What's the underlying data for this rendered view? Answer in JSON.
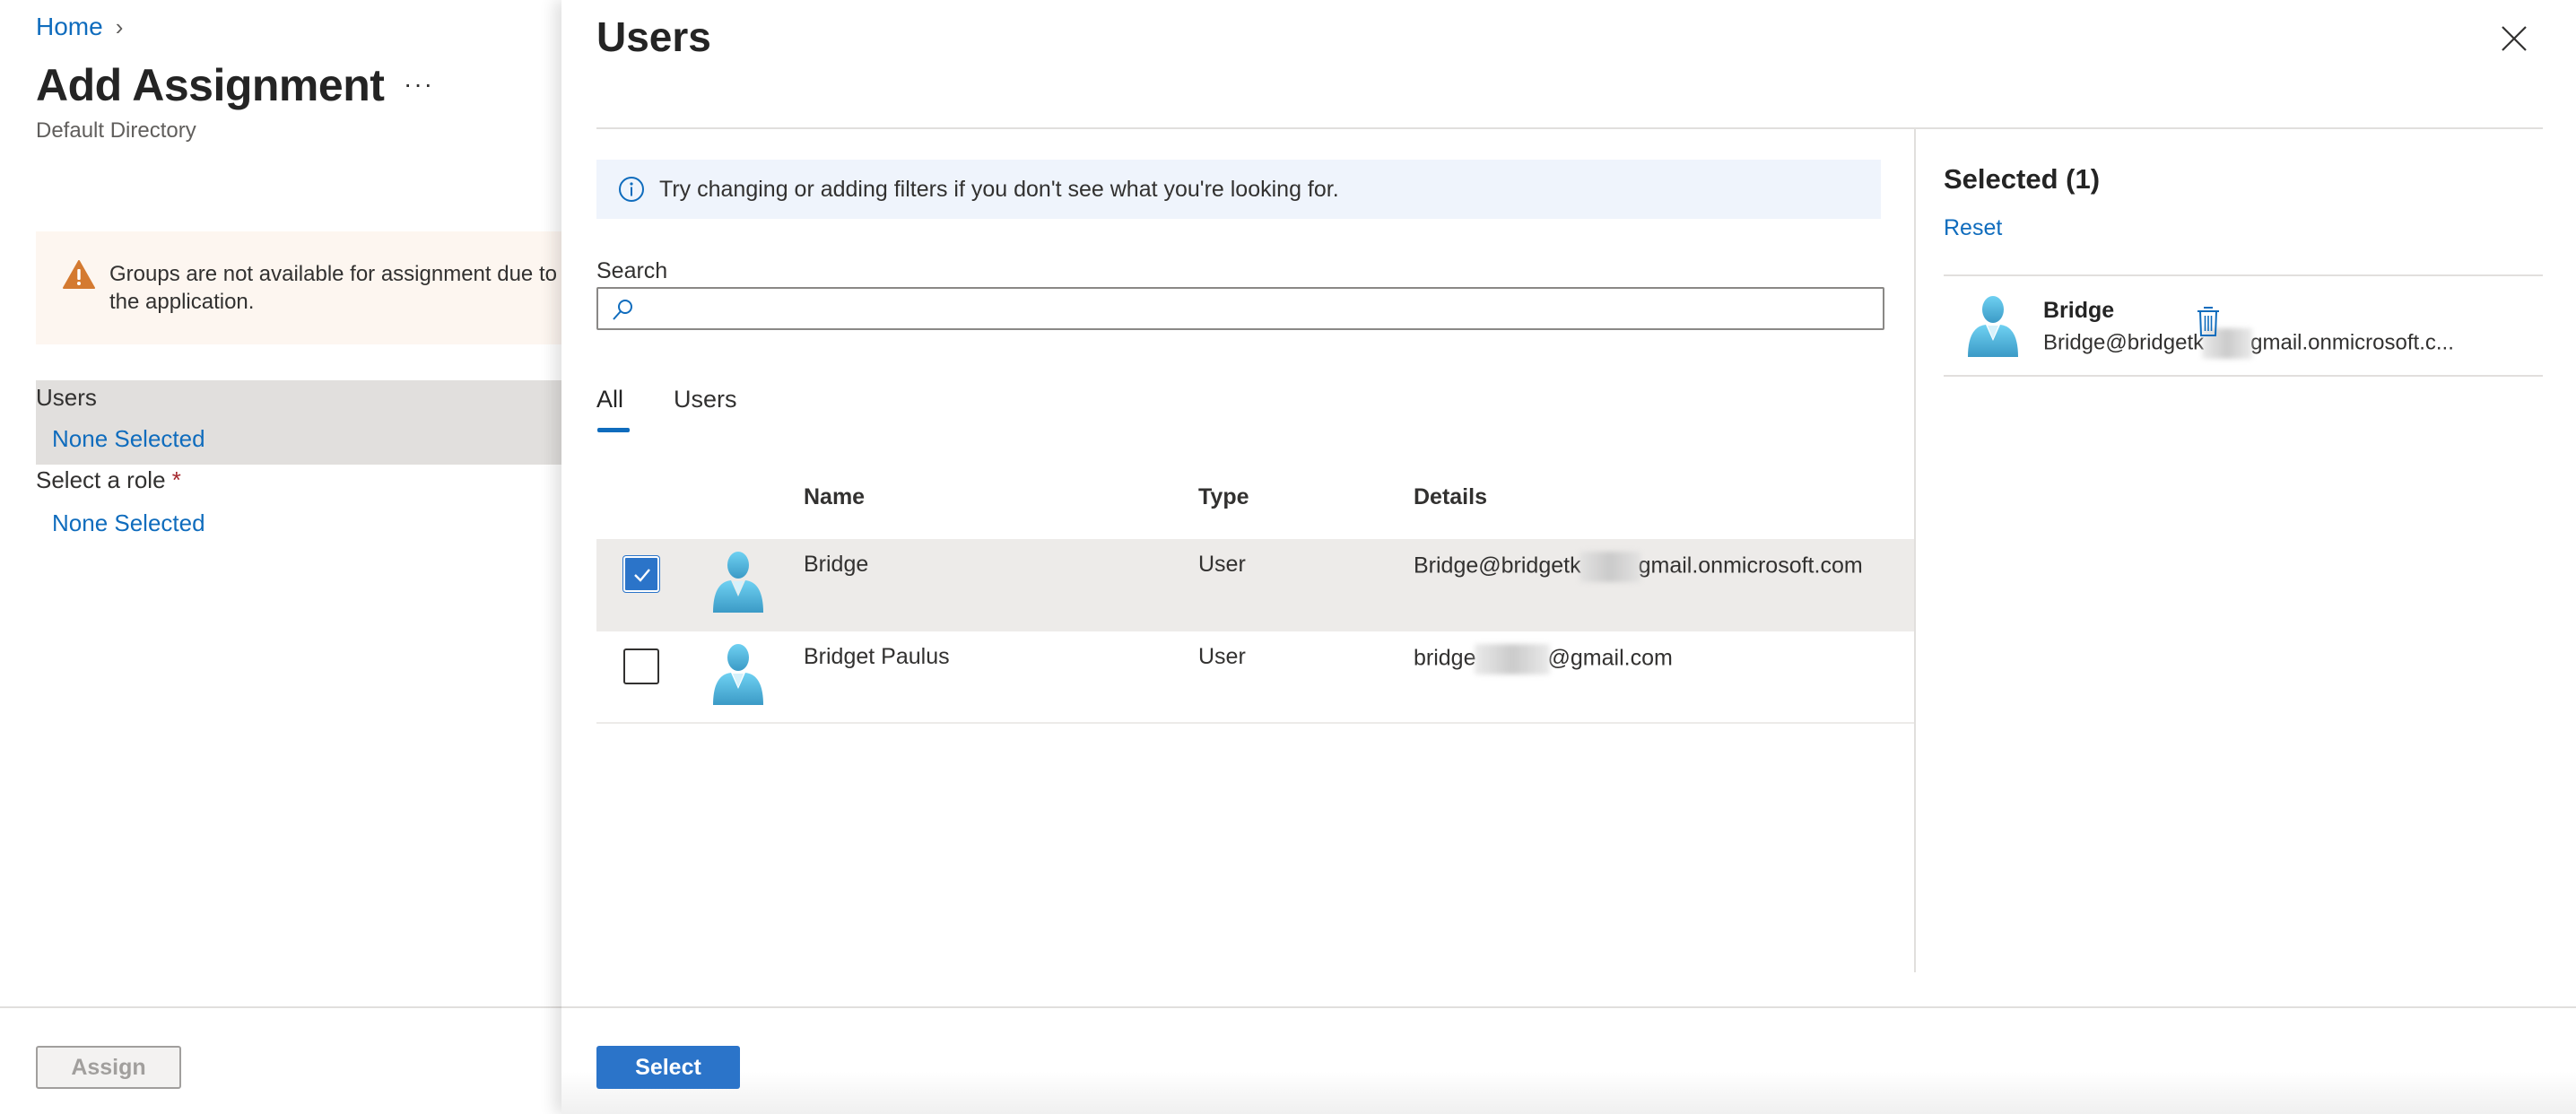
{
  "left_blade": {
    "breadcrumb": {
      "home": "Home",
      "separator": "›"
    },
    "title": "Add Assignment",
    "more": "···",
    "subtitle": "Default Directory",
    "warning": {
      "line1": "Groups are not available for assignment due to",
      "line2": "the application."
    },
    "users_field": {
      "label": "Users",
      "value": "None Selected"
    },
    "role_field": {
      "label": "Select a role",
      "required_mark": "*",
      "value": "None Selected"
    },
    "assign_button": "Assign"
  },
  "panel": {
    "title": "Users",
    "info": "Try changing or adding filters if you don't see what you're looking for.",
    "search": {
      "label": "Search",
      "value": "",
      "placeholder": ""
    },
    "tabs": [
      {
        "label": "All",
        "active": true
      },
      {
        "label": "Users",
        "active": false
      }
    ],
    "table": {
      "columns": {
        "name": "Name",
        "type": "Type",
        "details": "Details"
      },
      "rows": [
        {
          "checked": true,
          "name": "Bridge",
          "type": "User",
          "details_prefix": "Bridge@bridgetk",
          "details_suffix": "gmail.onmicrosoft.com"
        },
        {
          "checked": false,
          "name": "Bridget Paulus",
          "type": "User",
          "details_prefix": "bridge",
          "details_suffix": "@gmail.com"
        }
      ]
    },
    "selected": {
      "title": "Selected (1)",
      "reset": "Reset",
      "items": [
        {
          "name": "Bridge",
          "email_prefix": "Bridge@bridgetk",
          "email_suffix": "gmail.onmicrosoft.c..."
        }
      ]
    },
    "select_button": "Select"
  },
  "colors": {
    "accent": "#2b74c9",
    "link": "#0f6cbd",
    "warning_bg": "#fdf6f0",
    "warning_icon": "#d47a31",
    "info_bg": "#eff4fc",
    "selected_row": "#edebe9"
  }
}
